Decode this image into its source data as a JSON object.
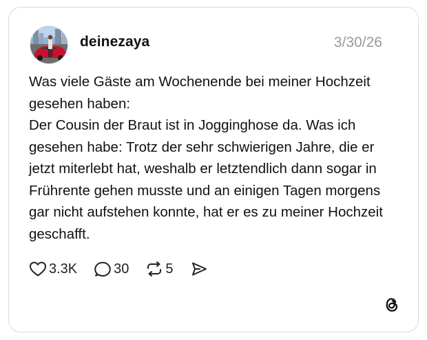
{
  "post": {
    "username": "deinezaya",
    "date": "3/30/26",
    "text": "Was viele Gäste am Wochenende bei meiner Hochzeit gesehen haben:\nDer Cousin der Braut ist in Jogginghose da. Was ich gesehen habe: Trotz der sehr schwierigen Jahre, die er jetzt miterlebt hat, weshalb er letztendlich dann sogar in Frührente gehen musste und an einigen Tagen morgens gar nicht aufstehen konnte, hat er es zu meiner Hochzeit geschafft."
  },
  "actions": {
    "likes": "3.3K",
    "replies": "30",
    "reposts": "5"
  },
  "icons": {
    "like": "heart-icon",
    "reply": "speech-bubble-icon",
    "repost": "repost-icon",
    "share": "send-icon",
    "brand": "threads-logo-icon"
  },
  "colors": {
    "text": "#111111",
    "muted": "#999999",
    "border": "#d9d9d9"
  }
}
